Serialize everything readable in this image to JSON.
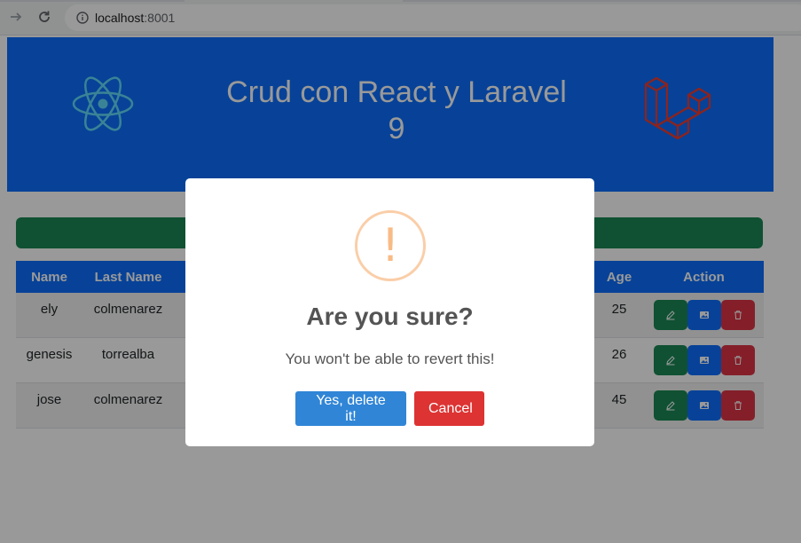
{
  "browser": {
    "host": "localhost",
    "port": ":8001"
  },
  "header": {
    "title_line1": "Crud con React y Laravel",
    "title_line2": "9",
    "colors": {
      "banner": "#0d6efd",
      "react_logo": "#61dafb",
      "laravel_logo": "#ef3b2d"
    }
  },
  "table": {
    "columns": [
      "Name",
      "Last Name",
      "Age",
      "Action"
    ],
    "rows": [
      {
        "name": "ely",
        "last_name": "colmenarez",
        "age": "25"
      },
      {
        "name": "genesis",
        "last_name": "torrealba",
        "age": "26"
      },
      {
        "name": "jose",
        "last_name": "colmenarez",
        "age": "45"
      }
    ],
    "action_icons": [
      "pencil-icon",
      "image-icon",
      "trash-icon"
    ]
  },
  "modal": {
    "icon": "!",
    "title": "Are you sure?",
    "text": "You won't be able to revert this!",
    "confirm_label": "Yes, delete it!",
    "cancel_label": "Cancel",
    "colors": {
      "confirm": "#3085d6",
      "cancel": "#dd3333",
      "icon": "#f8bb86"
    }
  }
}
